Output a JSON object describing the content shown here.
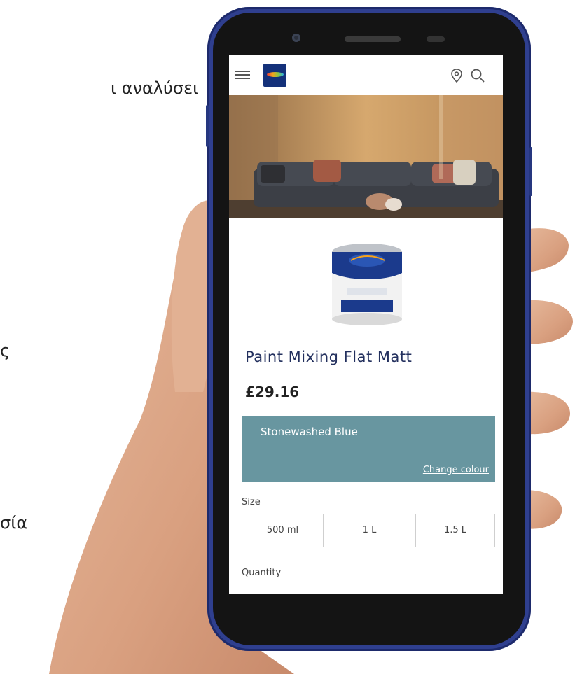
{
  "background_text": {
    "line1": "ι αναλύσει",
    "line2": "ς",
    "line3": "σία"
  },
  "app": {
    "header": {
      "menu_icon": "hamburger-menu-icon",
      "logo_icon": "lets-colour-logo-icon",
      "location_icon": "location-pin-icon",
      "search_icon": "search-icon"
    },
    "product": {
      "name": "Paint Mixing Flat Matt",
      "price": "£29.16",
      "selected_colour": "Stonewashed Blue",
      "selected_colour_hex": "#6896a0",
      "change_colour_label": "Change colour",
      "size_label": "Size",
      "sizes": [
        "500 ml",
        "1 L",
        "1.5 L"
      ],
      "quantity_label": "Quantity"
    }
  },
  "colors": {
    "phone_frame": "#2f3f8f",
    "brand_navy": "#14317a",
    "title_navy": "#23305e"
  }
}
